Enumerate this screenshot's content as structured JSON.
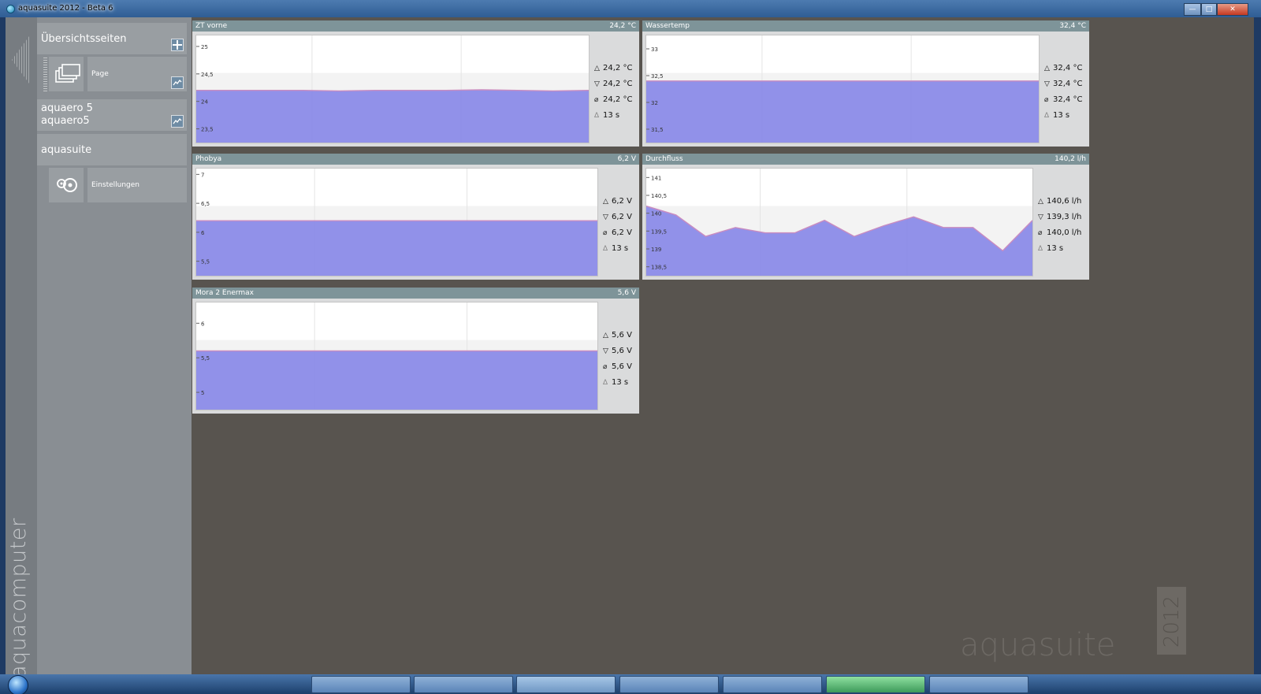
{
  "window": {
    "title": "aquasuite 2012 - Beta 6"
  },
  "sidebar": {
    "brand": "aquacomputer",
    "sections": [
      {
        "label": "Übersichtsseiten",
        "icon": "grid-icon"
      },
      {
        "label": "aquaero 5\naquaero5",
        "icon": "chart-icon"
      },
      {
        "label": "aquasuite"
      }
    ],
    "page_item": {
      "label": "Page",
      "icon": "pages-icon"
    },
    "settings_item": {
      "label": "Einstellungen",
      "icon": "settings-icon"
    }
  },
  "panels": [
    {
      "title": "ZT vorne",
      "value": "24,2 °C",
      "yticks": [
        "25",
        "24,5",
        "24",
        "23,5"
      ],
      "stats": {
        "max": "24,2 °C",
        "min": "24,2 °C",
        "avg": "24,2 °C",
        "interval": "13 s"
      }
    },
    {
      "title": "Wassertemp",
      "value": "32,4 °C",
      "yticks": [
        "33",
        "32,5",
        "32",
        "31,5"
      ],
      "stats": {
        "max": "32,4 °C",
        "min": "32,4 °C",
        "avg": "32,4 °C",
        "interval": "13 s"
      }
    },
    {
      "title": "Phobya",
      "value": "6,2 V",
      "yticks": [
        "7",
        "6,5",
        "6",
        "5,5"
      ],
      "stats": {
        "max": "6,2 V",
        "min": "6,2 V",
        "avg": "6,2 V",
        "interval": "13 s"
      }
    },
    {
      "title": "Durchfluss",
      "value": "140,2 l/h",
      "yticks": [
        "141",
        "140,5",
        "140",
        "139,5",
        "139",
        "138,5"
      ],
      "stats": {
        "max": "140,6 l/h",
        "min": "139,3 l/h",
        "avg": "140,0 l/h",
        "interval": "13 s"
      }
    },
    {
      "title": "Mora 2 Enermax",
      "value": "5,6 V",
      "yticks": [
        "6",
        "5,5",
        "5"
      ],
      "stats": {
        "max": "5,6 V",
        "min": "5,6 V",
        "avg": "5,6 V",
        "interval": "13 s"
      }
    }
  ],
  "series": {
    "zt_vorne": {
      "ymin": 23.25,
      "ymax": 25.2,
      "values": [
        24.2,
        24.2,
        24.2,
        24.2,
        24.19,
        24.2,
        24.2,
        24.2,
        24.21,
        24.2,
        24.19,
        24.2
      ]
    },
    "wassertemp": {
      "ymin": 31.25,
      "ymax": 33.25,
      "values": [
        32.4,
        32.4,
        32.4,
        32.4,
        32.4,
        32.4,
        32.4,
        32.4,
        32.4,
        32.4,
        32.4,
        32.4
      ]
    },
    "phobya": {
      "ymin": 5.25,
      "ymax": 7.1,
      "values": [
        6.2,
        6.2,
        6.2,
        6.2,
        6.2,
        6.2,
        6.2,
        6.2,
        6.2,
        6.2,
        6.2,
        6.2
      ]
    },
    "durchfluss": {
      "ymin": 138.25,
      "ymax": 141.25,
      "values": [
        140.2,
        139.95,
        139.35,
        139.6,
        139.45,
        139.45,
        139.8,
        139.35,
        139.65,
        139.9,
        139.6,
        139.6,
        138.95,
        139.8
      ]
    },
    "mora": {
      "ymin": 4.75,
      "ymax": 6.3,
      "values": [
        5.6,
        5.6,
        5.6,
        5.6,
        5.6,
        5.6,
        5.6,
        5.6,
        5.6,
        5.6,
        5.6,
        5.6
      ]
    }
  },
  "watermark": {
    "text": "aquasuite",
    "year": "2012"
  },
  "colors": {
    "fill": "#8b8be8",
    "line": "#c98cc0",
    "header": "#7e9499",
    "background": "#58544f"
  }
}
